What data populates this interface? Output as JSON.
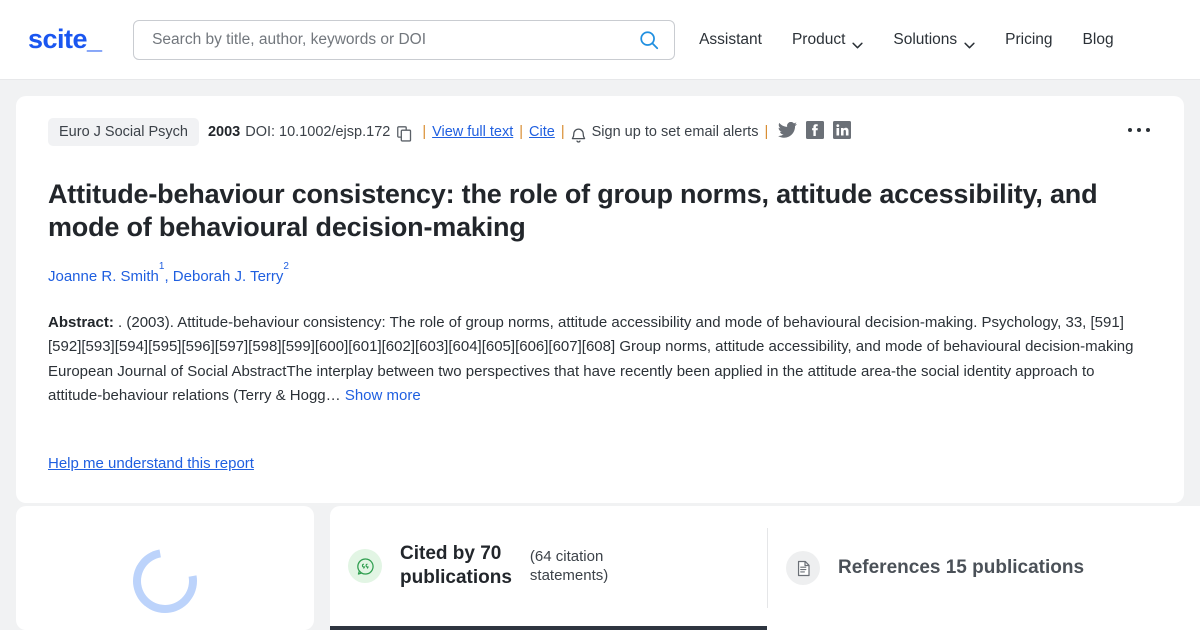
{
  "brand": {
    "logo": "scite",
    "logo_underscore": "_",
    "accent": "#1a56f0"
  },
  "header": {
    "search": {
      "placeholder": "Search by title, author, keywords or DOI",
      "value": ""
    },
    "nav": [
      {
        "label": "Assistant",
        "has_caret": false
      },
      {
        "label": "Product",
        "has_caret": true
      },
      {
        "label": "Solutions",
        "has_caret": true
      },
      {
        "label": "Pricing",
        "has_caret": false
      },
      {
        "label": "Blog",
        "has_caret": false
      }
    ]
  },
  "record": {
    "journal": "Euro J Social Psych",
    "year": "2003",
    "doi": "DOI: 10.1002/ejsp.172",
    "view_full_text": "View full text",
    "cite": "Cite",
    "alerts": "Sign up to set email alerts",
    "separator": "|",
    "title": "Attitude-behaviour consistency: the role of group norms, attitude accessibility, and mode of behavioural decision-making",
    "authors": [
      {
        "name": "Joanne R. Smith",
        "affiliation": "1"
      },
      {
        "name": "Deborah J. Terry",
        "affiliation": "2"
      }
    ],
    "author_separator": ", ",
    "abstract_label": "Abstract:",
    "abstract_text": " . (2003). Attitude-behaviour consistency: The role of group norms, attitude accessibility and mode of behavioural decision-making. Psychology, 33, [591][592][593][594][595][596][597][598][599][600][601][602][603][604][605][606][607][608] Group norms, attitude accessibility, and mode of behavioural decision-making European Journal of Social AbstractThe interplay between two perspectives that have recently been applied in the attitude area-the social identity approach to attitude-behaviour relations (Terry & Hogg… ",
    "show_more": "Show more",
    "help_link": "Help me understand this report"
  },
  "panels": {
    "loading": {
      "status": "loading"
    },
    "tabs": [
      {
        "id": "cited-by",
        "icon": "quote-bubble-icon",
        "main_line1": "Cited by 70",
        "main_line2": "publications",
        "sub_line1": "(64 citation",
        "sub_line2": "statements)",
        "active": true
      },
      {
        "id": "references",
        "icon": "document-icon",
        "label": "References 15 publications",
        "active": false
      }
    ]
  },
  "icons": {
    "search": "search-icon",
    "copy": "copy-icon",
    "bell": "bell-icon",
    "twitter": "twitter-icon",
    "facebook": "facebook-icon",
    "linkedin": "linkedin-icon",
    "kebab": "more-options-icon"
  }
}
